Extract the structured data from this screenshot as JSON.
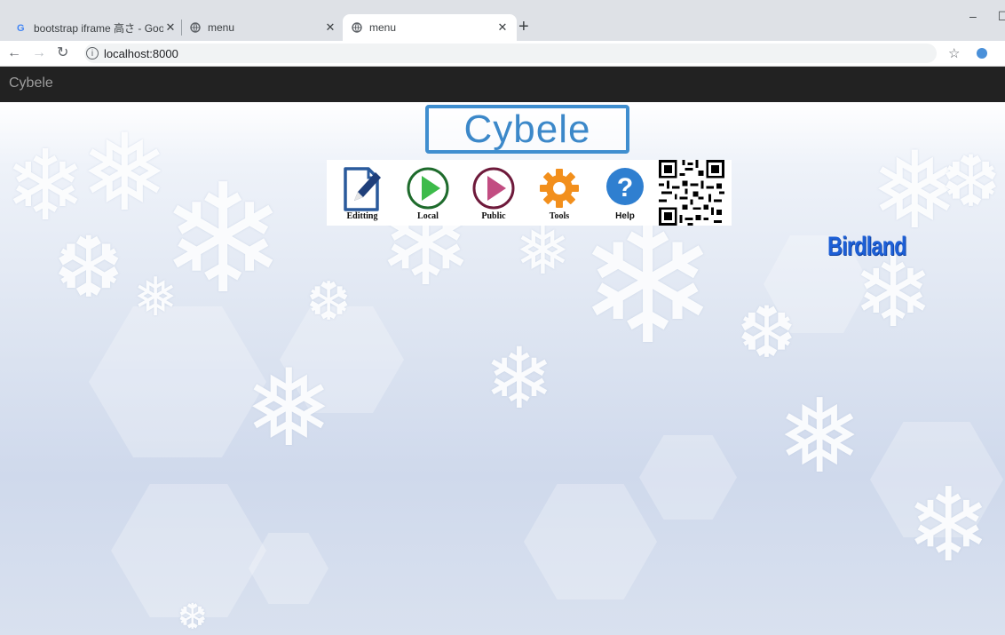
{
  "browser": {
    "tabs": [
      {
        "title": "bootstrap iframe 高さ - Google 検",
        "favicon": "google-icon"
      },
      {
        "title": "menu",
        "favicon": "globe-icon"
      },
      {
        "title": "menu",
        "favicon": "globe-icon",
        "active": true
      }
    ],
    "url": "localhost:8000",
    "new_tab_symbol": "+",
    "close_symbol": "✕"
  },
  "page": {
    "brand": "Cybele",
    "logo_text": "Cybele",
    "menu": [
      {
        "label": "Editting",
        "icon": "edit-document-icon"
      },
      {
        "label": "Local",
        "icon": "play-green-icon"
      },
      {
        "label": "Public",
        "icon": "play-pink-icon"
      },
      {
        "label": "Tools",
        "icon": "gear-icon"
      },
      {
        "label": "Help",
        "icon": "help-icon"
      }
    ],
    "birdland": "Birdland"
  },
  "colors": {
    "navbar": "#222222",
    "logo_border": "#3f8ecf",
    "play_green": "#3dbb4a",
    "play_pink": "#c24d82",
    "gear": "#f28f1c",
    "help": "#2f7fd0",
    "birdland": "#1d5fd6"
  }
}
